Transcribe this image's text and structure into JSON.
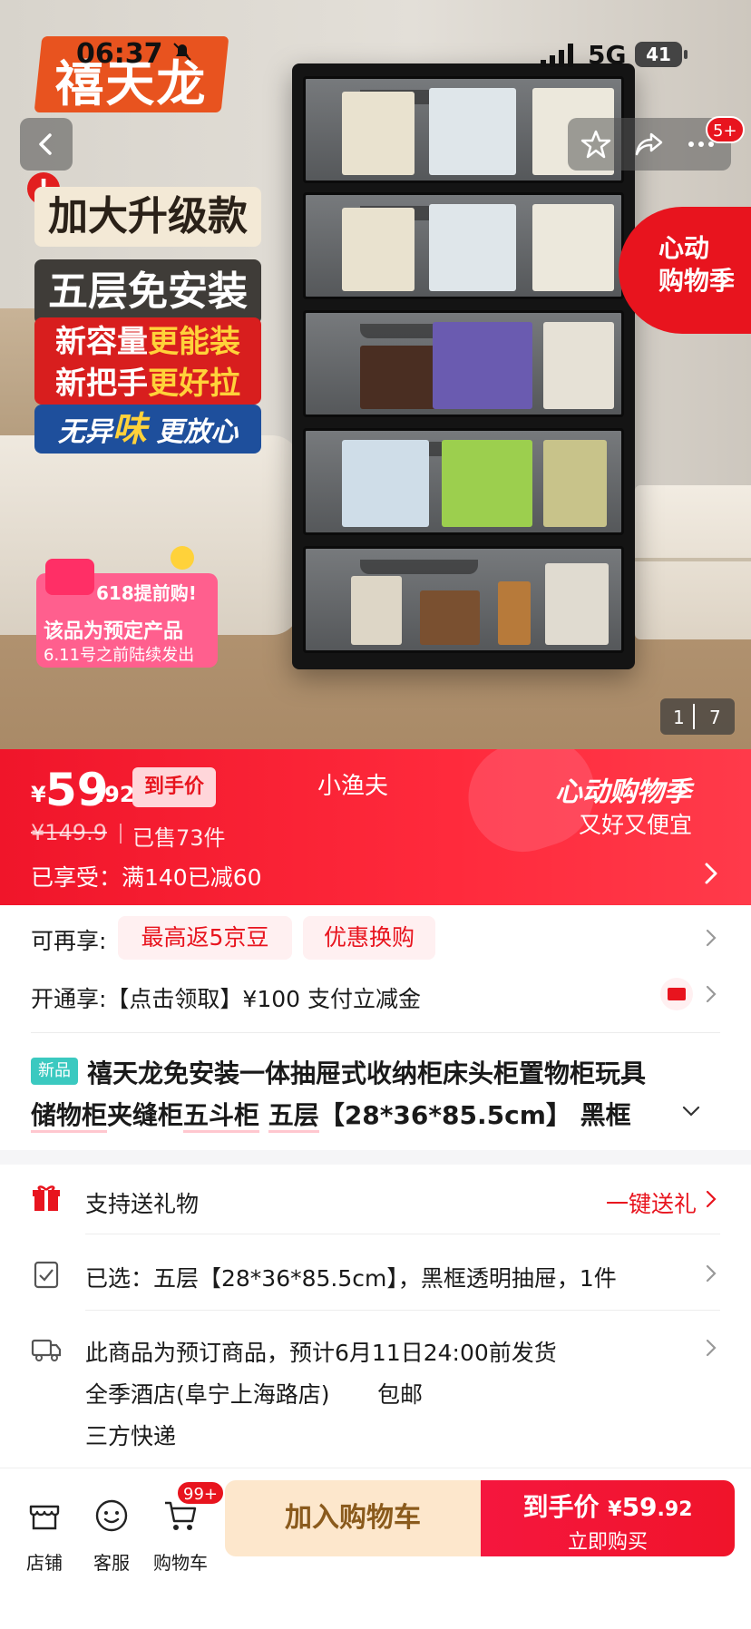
{
  "status_bar": {
    "time": "06:37",
    "network": "5G",
    "battery": "41"
  },
  "hero": {
    "brand_logo": "禧天龙",
    "promo_lines": {
      "line1": "加大升级款",
      "line2": "五层免安装",
      "line3a_white": "新容量",
      "line3a_yellow": "更能装",
      "line3b_white": "新把手",
      "line3b_yellow": "更好拉",
      "line4_white_a": "无异",
      "line4_yellow": "味",
      "line4_white_b": " 更放心"
    },
    "preorder": {
      "title": "618提前购!",
      "line1": "该品为预定产品",
      "line2": "6.11号之前陆续发出"
    },
    "event_badge": {
      "line1": "心动",
      "line2": "购物季"
    },
    "message_badge": "5+",
    "image_index": "1",
    "image_total": "7"
  },
  "price": {
    "currency": "¥",
    "integer": "59",
    "decimal": ".92",
    "tag": "到手价",
    "shop_name": "小渔夫",
    "original": "¥149.9",
    "sold": "已售73件",
    "discount": "已享受：满140已减60",
    "event_title": "心动购物季",
    "event_sub": "又好又便宜"
  },
  "benefits": {
    "label": "可再享:",
    "pill1": "最高返5京豆",
    "pill2": "优惠换购",
    "open_label": "开通享:【点击领取】¥100 支付立减金"
  },
  "product": {
    "new_tag": "新品",
    "title_line1": "禧天龙免安装一体抽屉式收纳柜床头柜置物柜玩具",
    "title_line2_a": "储物柜",
    "title_line2_b": "夹缝柜",
    "title_line2_c": "五斗柜",
    "title_line2_d": " ",
    "title_line2_e": "五层",
    "title_line2_f": "【28*36*85.5cm】 黑框"
  },
  "info_rows": {
    "gift": "支持送礼物",
    "gift_action": "一键送礼",
    "selected": "已选：五层【28*36*85.5cm】，黑框透明抽屉，1件",
    "shipping_line1": "此商品为预订商品，预计6月11日24:00前发货",
    "shipping_line2": "全季酒店(阜宁上海路店)",
    "shipping_free": "包邮",
    "shipping_line3": "三方快递"
  },
  "bottom_bar": {
    "store": "店铺",
    "service": "客服",
    "cart": "购物车",
    "cart_badge": "99+",
    "add_to_cart": "加入购物车",
    "buy_label": "到手价",
    "buy_currency": "¥",
    "buy_integer": "59",
    "buy_decimal": ".92",
    "buy_now": "立即购买"
  },
  "colors": {
    "accent": "#e8141e",
    "price_band": "#f0152a",
    "cart_button": "#fde7cc"
  }
}
